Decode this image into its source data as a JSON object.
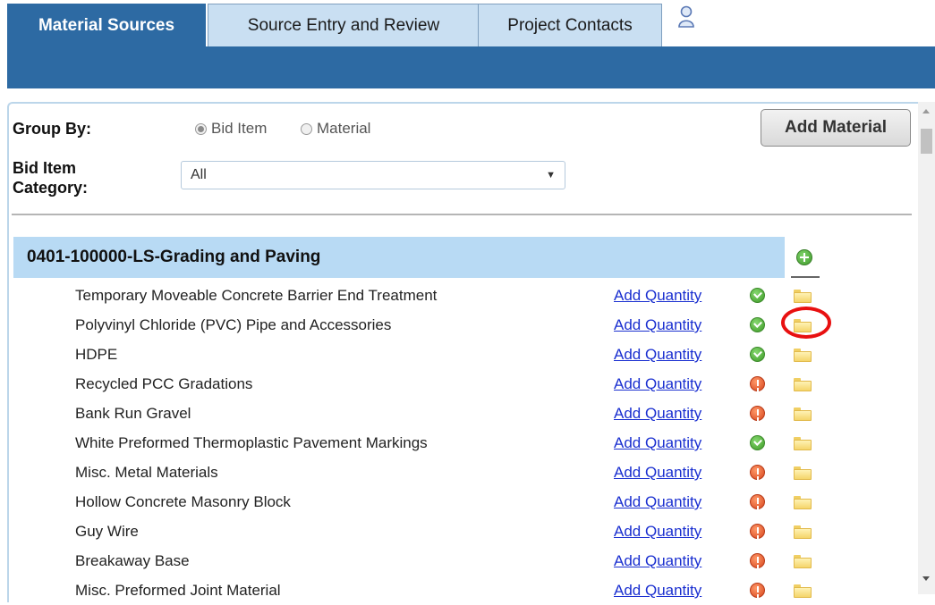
{
  "tabs": [
    {
      "label": "Material Sources",
      "active": true
    },
    {
      "label": "Source Entry and Review",
      "active": false
    },
    {
      "label": "Project Contacts",
      "active": false
    }
  ],
  "user_icon": "user-icon",
  "filters": {
    "group_by_label": "Group By:",
    "group_by_options": [
      "Bid Item",
      "Material"
    ],
    "group_by_selected": "Bid Item",
    "category_label_line1": "Bid Item",
    "category_label_line2": "Category:",
    "category_value": "All"
  },
  "add_material_label": "Add Material",
  "group": {
    "title": "0401-100000-LS-Grading and Paving",
    "add_icon": "plus-circle-icon"
  },
  "add_quantity_label": "Add Quantity",
  "items": [
    {
      "name": "Temporary Moveable Concrete Barrier End Treatment",
      "status": "ok"
    },
    {
      "name": "Polyvinyl Chloride (PVC) Pipe and Accessories",
      "status": "ok"
    },
    {
      "name": "HDPE",
      "status": "ok"
    },
    {
      "name": "Recycled PCC Gradations",
      "status": "warn"
    },
    {
      "name": "Bank Run Gravel",
      "status": "warn"
    },
    {
      "name": "White Preformed Thermoplastic Pavement Markings",
      "status": "ok"
    },
    {
      "name": "Misc. Metal Materials",
      "status": "warn"
    },
    {
      "name": "Hollow Concrete Masonry Block",
      "status": "warn"
    },
    {
      "name": "Guy Wire",
      "status": "warn"
    },
    {
      "name": "Breakaway Base",
      "status": "warn"
    },
    {
      "name": "Misc. Preformed Joint Material",
      "status": "warn"
    }
  ],
  "annotation": {
    "circled_item_index": 1,
    "color": "#e81010"
  },
  "colors": {
    "accent": "#2d6aa3",
    "group_header": "#b8daf4",
    "link": "#1a2fd0"
  }
}
